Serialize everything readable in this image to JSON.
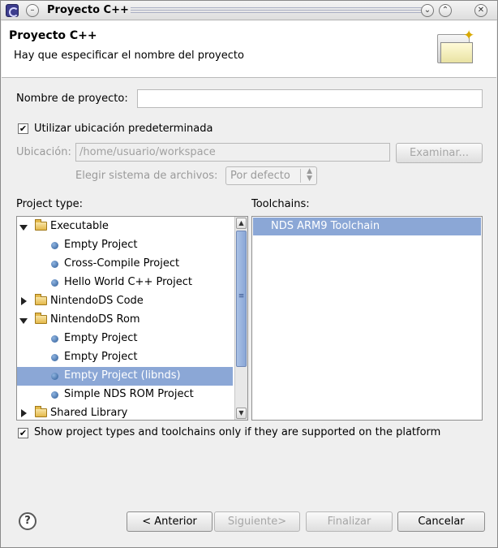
{
  "window": {
    "title": "Proyecto C++"
  },
  "header": {
    "title": "Proyecto C++",
    "description": "Hay que especificar el nombre del proyecto"
  },
  "project_name": {
    "label": "Nombre de proyecto:",
    "value": ""
  },
  "use_default_location": {
    "label": "Utilizar ubicación predeterminada",
    "checked": true
  },
  "location": {
    "label": "Ubicación:",
    "value": "/home/usuario/workspace",
    "browse_label": "Examinar..."
  },
  "filesystem": {
    "label": "Elegir sistema de archivos:",
    "selected": "Por defecto"
  },
  "project_types": {
    "label": "Project type:",
    "items": [
      {
        "label": "Executable",
        "kind": "folder",
        "state": "expanded",
        "level": 0
      },
      {
        "label": "Empty Project",
        "kind": "item",
        "level": 1
      },
      {
        "label": "Cross-Compile Project",
        "kind": "item",
        "level": 1
      },
      {
        "label": "Hello World C++ Project",
        "kind": "item",
        "level": 1
      },
      {
        "label": "NintendoDS Code",
        "kind": "folder",
        "state": "collapsed",
        "level": 0
      },
      {
        "label": "NintendoDS Rom",
        "kind": "folder",
        "state": "expanded",
        "level": 0
      },
      {
        "label": "Empty Project",
        "kind": "item",
        "level": 1
      },
      {
        "label": "Empty Project",
        "kind": "item",
        "level": 1
      },
      {
        "label": "Empty Project (libnds)",
        "kind": "item",
        "level": 1,
        "selected": true
      },
      {
        "label": "Simple NDS ROM Project",
        "kind": "item",
        "level": 1
      },
      {
        "label": "Shared Library",
        "kind": "folder",
        "state": "collapsed",
        "level": 0
      }
    ]
  },
  "toolchains": {
    "label": "Toolchains:",
    "items": [
      {
        "label": "NDS ARM9 Toolchain",
        "selected": true
      }
    ]
  },
  "show_supported": {
    "label": "Show project types and toolchains only if they are supported on the platform",
    "checked": true
  },
  "buttons": {
    "back": "< Anterior",
    "next": "Siguiente>",
    "finish": "Finalizar",
    "cancel": "Cancelar"
  },
  "colors": {
    "selection": "#8ba7d6",
    "header_bg": "#ffffff",
    "dialog_bg": "#efefef"
  }
}
